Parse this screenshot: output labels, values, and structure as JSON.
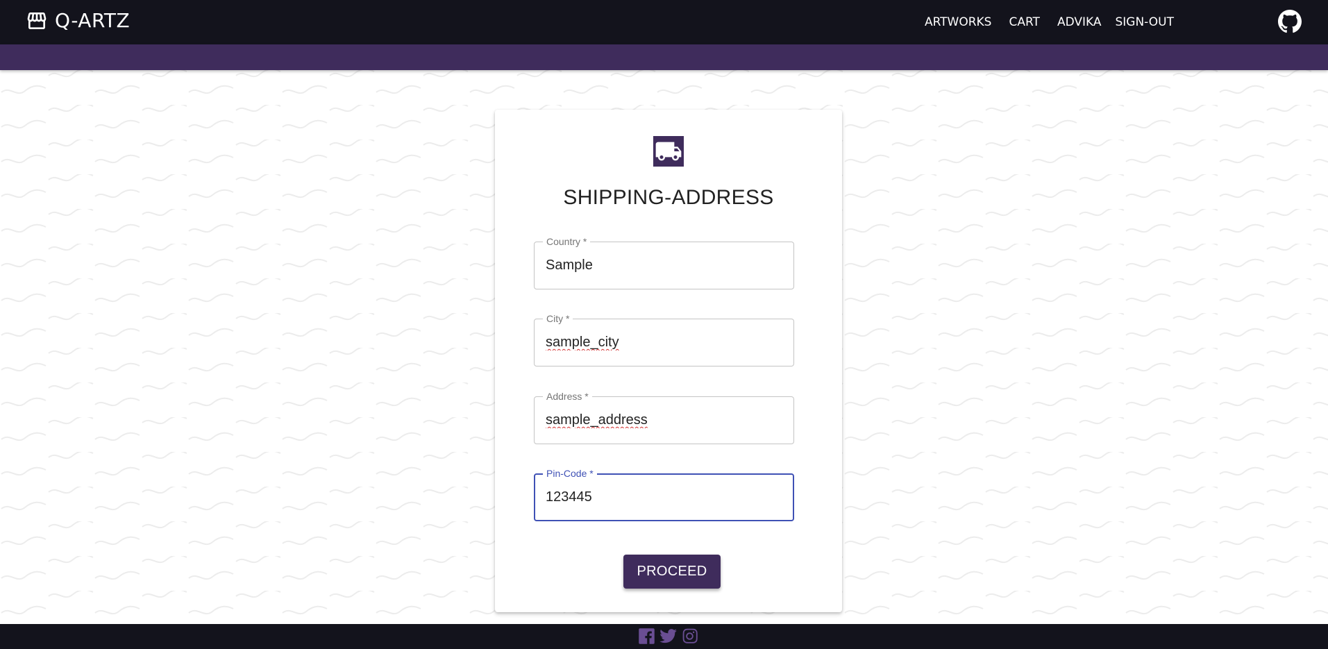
{
  "app": {
    "brand": "Q-ARTZ"
  },
  "nav": {
    "links": [
      "ARTWORKS",
      "CART",
      "ADVIKA",
      "SIGN-OUT"
    ]
  },
  "form": {
    "title": "SHIPPING-ADDRESS",
    "fields": [
      {
        "label": "Country *",
        "value": "Sample",
        "focused": false,
        "spellcheck_error": false
      },
      {
        "label": "City *",
        "value": "sample_city",
        "focused": false,
        "spellcheck_error": true
      },
      {
        "label": "Address *",
        "value": "sample_address",
        "focused": false,
        "spellcheck_error": true
      },
      {
        "label": "Pin-Code *",
        "value": "123445",
        "focused": true,
        "spellcheck_error": false
      }
    ],
    "submit_label": "PROCEED"
  },
  "footer": {
    "social_icons": [
      "facebook-icon",
      "twitter-icon",
      "instagram-icon"
    ]
  },
  "colors": {
    "navbar": "#13131c",
    "accent": "#3f2c5c",
    "focus": "#3f51b5",
    "social_icon": "#6a4e93"
  }
}
